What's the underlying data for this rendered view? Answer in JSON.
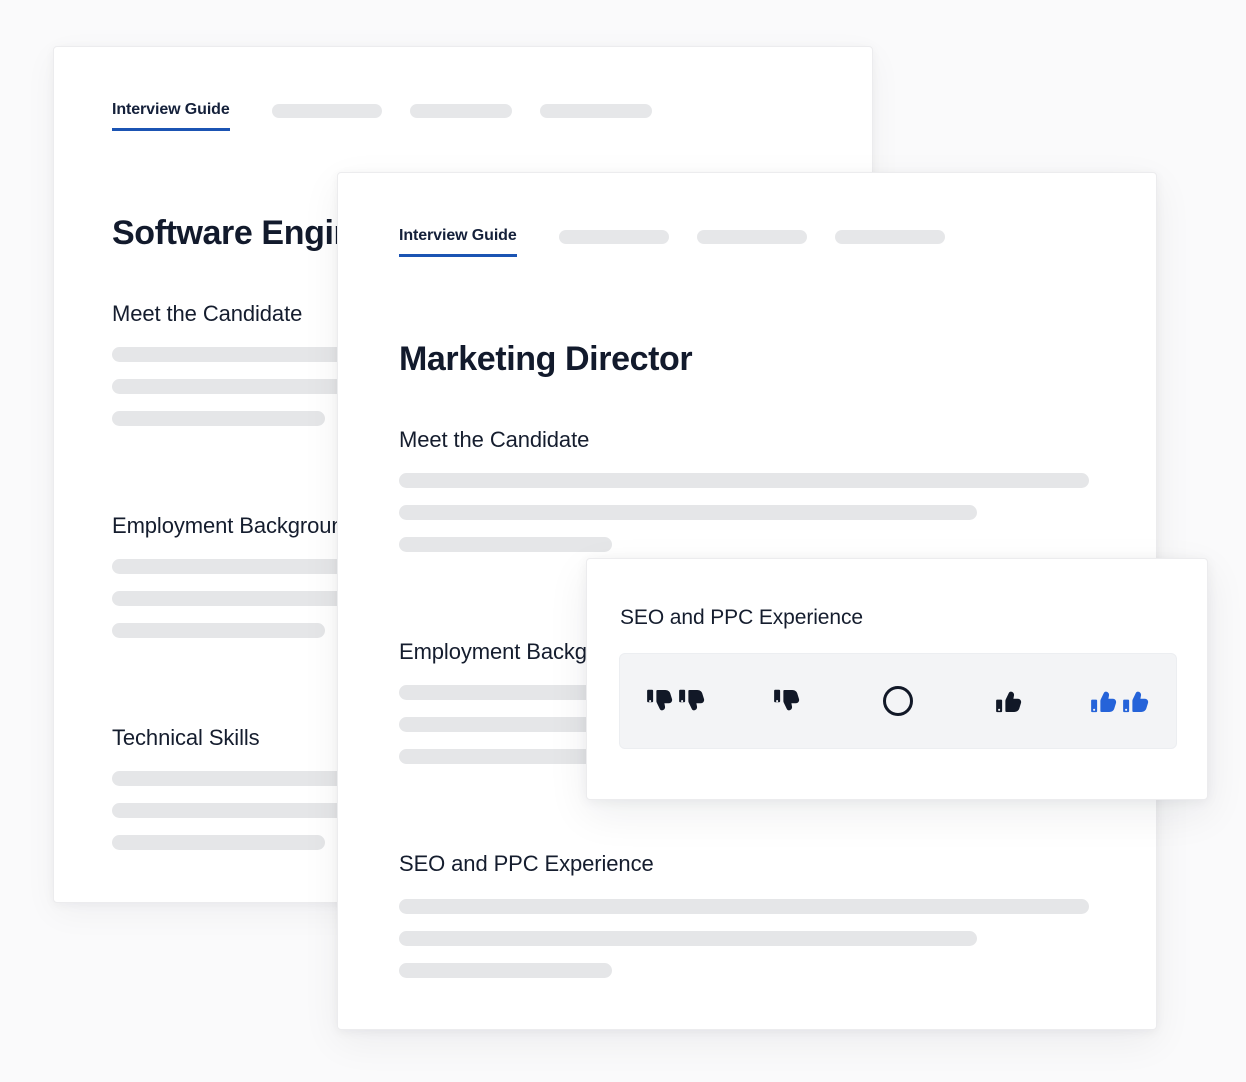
{
  "theme": {
    "page_background": "#fafafb",
    "card_background": "#ffffff",
    "accent_blue": "#1b54b3",
    "selected_blue": "#2563d9",
    "icon_dark": "#111827",
    "skeleton_gray": "#e5e6e8",
    "strip_background": "#f3f4f6",
    "heading_color": "#151d2e"
  },
  "back_card": {
    "tabs": {
      "active_label": "Interview Guide",
      "placeholder_widths": [
        110,
        102,
        112
      ]
    },
    "title": "Software Engineer",
    "sections": [
      {
        "heading": "Meet the Candidate",
        "line_widths": [
          690,
          578,
          213
        ]
      },
      {
        "heading": "Employment Background",
        "line_widths": [
          690,
          578,
          213
        ]
      },
      {
        "heading": "Technical Skills",
        "line_widths": [
          690,
          578,
          213
        ]
      }
    ]
  },
  "front_card": {
    "tabs": {
      "active_label": "Interview Guide",
      "placeholder_widths": [
        110,
        110,
        110
      ]
    },
    "title": "Marketing Director",
    "sections": [
      {
        "heading": "Meet the Candidate",
        "line_widths": [
          690,
          578,
          213
        ]
      },
      {
        "heading": "Employment Background",
        "line_widths": [
          690,
          578,
          213
        ]
      },
      {
        "heading": "SEO and PPC Experience",
        "line_widths": [
          690,
          578,
          213
        ]
      }
    ]
  },
  "rating_popover": {
    "title": "SEO and PPC Experience",
    "options": [
      {
        "icon": "double-thumbs-down-icon",
        "label": "Strong No",
        "value": -2,
        "selected": false
      },
      {
        "icon": "thumbs-down-icon",
        "label": "No",
        "value": -1,
        "selected": false
      },
      {
        "icon": "circle-neutral-icon",
        "label": "Neutral",
        "value": 0,
        "selected": false
      },
      {
        "icon": "thumbs-up-icon",
        "label": "Yes",
        "value": 1,
        "selected": false
      },
      {
        "icon": "double-thumbs-up-icon",
        "label": "Strong Yes",
        "value": 2,
        "selected": true
      }
    ],
    "selected_value": 2
  }
}
